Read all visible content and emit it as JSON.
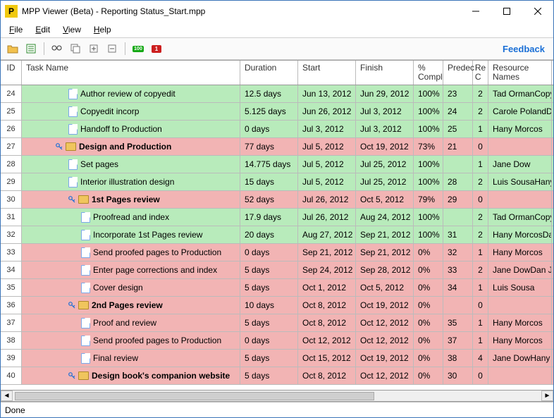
{
  "titlebar": {
    "app_icon_letter": "P",
    "title": "MPP Viewer (Beta) - Reporting Status_Start.mpp"
  },
  "menus": [
    "File",
    "Edit",
    "View",
    "Help"
  ],
  "toolbar": {
    "icons": [
      "open-icon",
      "export-icon",
      "find-icon",
      "copy-icon",
      "expand-all-icon",
      "collapse-all-icon",
      "complete-100-icon",
      "late-tasks-icon"
    ],
    "feedback": "Feedback"
  },
  "columns": {
    "id": "ID",
    "name": "Task Name",
    "dur": "Duration",
    "start": "Start",
    "finish": "Finish",
    "comp": "% Compl",
    "pred": "Predec",
    "rc": "Re C",
    "res": "Resource Names"
  },
  "rows": [
    {
      "id": "24",
      "indent": 2,
      "icon": "file",
      "name": "Author review of copyedit",
      "dur": "12.5 days",
      "start": "Jun 13, 2012",
      "finish": "Jun 29, 2012",
      "comp": "100%",
      "pred": "23",
      "rc": "2",
      "res": "Tad OrmanCopye",
      "color": "green"
    },
    {
      "id": "25",
      "indent": 2,
      "icon": "file",
      "name": "Copyedit incorp",
      "dur": "5.125 days",
      "start": "Jun 26, 2012",
      "finish": "Jul 3, 2012",
      "comp": "100%",
      "pred": "24",
      "rc": "2",
      "res": "Carole PolandDa",
      "color": "green"
    },
    {
      "id": "26",
      "indent": 2,
      "icon": "file",
      "name": "Handoff to Production",
      "dur": "0 days",
      "start": "Jul 3, 2012",
      "finish": "Jul 3, 2012",
      "comp": "100%",
      "pred": "25",
      "rc": "1",
      "res": "Hany Morcos",
      "color": "green"
    },
    {
      "id": "27",
      "indent": 1,
      "icon": "folder",
      "name": "Design and Production",
      "dur": "77 days",
      "start": "Jul 5, 2012",
      "finish": "Oct 19, 2012",
      "comp": "73%",
      "pred": "21",
      "rc": "0",
      "res": "",
      "color": "pink",
      "bold": true,
      "key": true
    },
    {
      "id": "28",
      "indent": 2,
      "icon": "file",
      "name": "Set pages",
      "dur": "14.775 days",
      "start": "Jul 5, 2012",
      "finish": "Jul 25, 2012",
      "comp": "100%",
      "pred": "",
      "rc": "1",
      "res": "Jane Dow",
      "color": "green"
    },
    {
      "id": "29",
      "indent": 2,
      "icon": "file",
      "name": "Interior illustration design",
      "dur": "15 days",
      "start": "Jul 5, 2012",
      "finish": "Jul 25, 2012",
      "comp": "100%",
      "pred": "28",
      "rc": "2",
      "res": "Luis SousaHany M",
      "color": "green"
    },
    {
      "id": "30",
      "indent": 2,
      "icon": "folder",
      "name": "1st Pages review",
      "dur": "52 days",
      "start": "Jul 26, 2012",
      "finish": "Oct 5, 2012",
      "comp": "79%",
      "pred": "29",
      "rc": "0",
      "res": "",
      "color": "pink",
      "bold": true,
      "key": true
    },
    {
      "id": "31",
      "indent": 3,
      "icon": "file",
      "name": "Proofread and index",
      "dur": "17.9 days",
      "start": "Jul 26, 2012",
      "finish": "Aug 24, 2012",
      "comp": "100%",
      "pred": "",
      "rc": "2",
      "res": "Tad OrmanCopye",
      "color": "green"
    },
    {
      "id": "32",
      "indent": 3,
      "icon": "file",
      "name": "Incorporate 1st Pages review",
      "dur": "20 days",
      "start": "Aug 27, 2012",
      "finish": "Sep 21, 2012",
      "comp": "100%",
      "pred": "31",
      "rc": "2",
      "res": "Hany MorcosDan",
      "color": "green"
    },
    {
      "id": "33",
      "indent": 3,
      "icon": "file",
      "name": "Send proofed pages to Production",
      "dur": "0 days",
      "start": "Sep 21, 2012",
      "finish": "Sep 21, 2012",
      "comp": "0%",
      "pred": "32",
      "rc": "1",
      "res": "Hany Morcos",
      "color": "pink"
    },
    {
      "id": "34",
      "indent": 3,
      "icon": "file",
      "name": "Enter page corrections and index",
      "dur": "5 days",
      "start": "Sep 24, 2012",
      "finish": "Sep 28, 2012",
      "comp": "0%",
      "pred": "33",
      "rc": "2",
      "res": "Jane DowDan Jur",
      "color": "pink"
    },
    {
      "id": "35",
      "indent": 3,
      "icon": "file",
      "name": "Cover design",
      "dur": "5 days",
      "start": "Oct 1, 2012",
      "finish": "Oct 5, 2012",
      "comp": "0%",
      "pred": "34",
      "rc": "1",
      "res": "Luis Sousa",
      "color": "pink"
    },
    {
      "id": "36",
      "indent": 2,
      "icon": "folder",
      "name": "2nd Pages review",
      "dur": "10 days",
      "start": "Oct 8, 2012",
      "finish": "Oct 19, 2012",
      "comp": "0%",
      "pred": "",
      "rc": "0",
      "res": "",
      "color": "pink",
      "bold": true,
      "key": true
    },
    {
      "id": "37",
      "indent": 3,
      "icon": "file",
      "name": "Proof and review",
      "dur": "5 days",
      "start": "Oct 8, 2012",
      "finish": "Oct 12, 2012",
      "comp": "0%",
      "pred": "35",
      "rc": "1",
      "res": "Hany Morcos",
      "color": "pink"
    },
    {
      "id": "38",
      "indent": 3,
      "icon": "file",
      "name": "Send proofed pages to Production",
      "dur": "0 days",
      "start": "Oct 12, 2012",
      "finish": "Oct 12, 2012",
      "comp": "0%",
      "pred": "37",
      "rc": "1",
      "res": "Hany Morcos",
      "color": "pink"
    },
    {
      "id": "39",
      "indent": 3,
      "icon": "file",
      "name": "Final review",
      "dur": "5 days",
      "start": "Oct 15, 2012",
      "finish": "Oct 19, 2012",
      "comp": "0%",
      "pred": "38",
      "rc": "4",
      "res": "Jane DowHany Mo",
      "color": "pink"
    },
    {
      "id": "40",
      "indent": 2,
      "icon": "folder",
      "name": "Design book's companion website",
      "dur": "5 days",
      "start": "Oct 8, 2012",
      "finish": "Oct 12, 2012",
      "comp": "0%",
      "pred": "30",
      "rc": "0",
      "res": "",
      "color": "pink",
      "bold": true,
      "key": true
    }
  ],
  "statusbar": {
    "text": "Done"
  },
  "badges": {
    "b100": "100",
    "b1": "1"
  }
}
